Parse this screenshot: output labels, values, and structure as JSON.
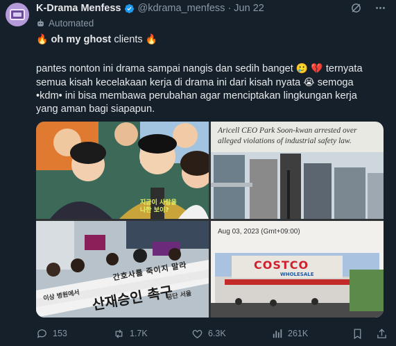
{
  "author": {
    "name": "K-Drama Menfess",
    "handle": "@kdrama_menfess",
    "separator": "·",
    "date": "Jun 22",
    "label": "Automated"
  },
  "tweet": {
    "line1_pre": "oh my ghost",
    "line1_post": "clients",
    "paragraph_a": "pantes nonton ini drama sampai nangis dan sedih banget",
    "paragraph_b": "ternyata semua kisah kecelakaan kerja di drama ini dari kisah nyata",
    "paragraph_c": "semoga •kdm• ini bisa membawa perubahan agar menciptakan lingkungan kerja yang aman bagi siapapun."
  },
  "media": {
    "poster_caption": "지금이 사랑을 나한 보이?",
    "news_headline": "Aricell CEO Park Soon-kwan arrested over alleged violations of industrial safety law.",
    "news_date": "Aug 03, 2023 (Gmt+09:00)",
    "protest_banner_top": "간호사를 죽이지 말라",
    "protest_banner_main": "산재승인 촉구",
    "protest_banner_small": "이상 병원에서",
    "protest_banner_right": "공단 서울",
    "store_sign": "COSTCO",
    "store_sub": "WHOLESALE"
  },
  "stats": {
    "replies": "153",
    "retweets": "1.7K",
    "likes": "6.3K",
    "views": "261K"
  },
  "icons": {
    "verified": "verified-badge-icon",
    "grok": "grok-icon",
    "more": "more-icon",
    "robot": "robot-icon",
    "reply": "reply-icon",
    "retweet": "retweet-icon",
    "like": "heart-icon",
    "views": "bar-chart-icon",
    "bookmark": "bookmark-icon",
    "share": "share-icon"
  },
  "colors": {
    "background": "#15202b",
    "text": "#e7e9ea",
    "muted": "#8b98a5",
    "verified": "#1d9bf0"
  }
}
